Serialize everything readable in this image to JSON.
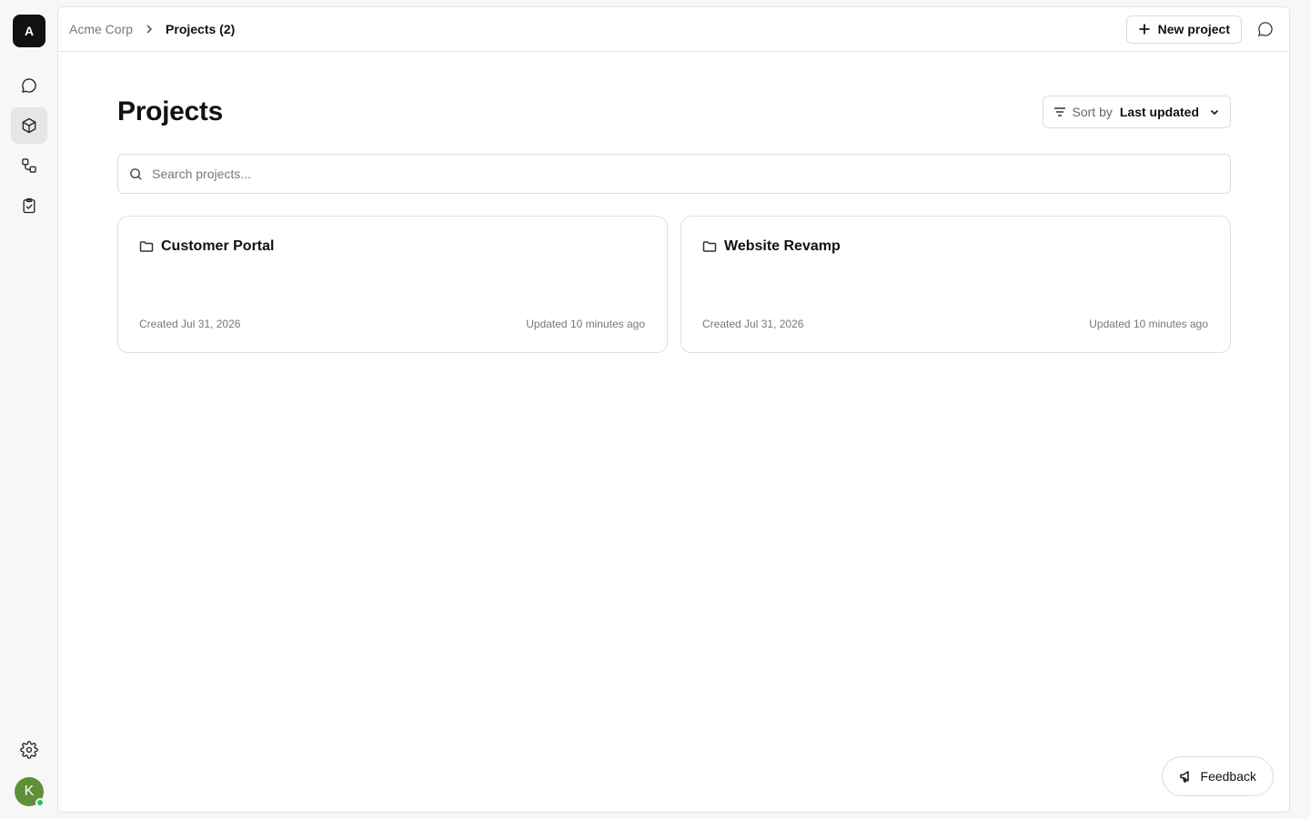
{
  "sidebar": {
    "org_initial": "A",
    "nav": [
      {
        "icon": "chat-bubble-icon",
        "active": false
      },
      {
        "icon": "cube-icon",
        "active": true
      },
      {
        "icon": "workflow-icon",
        "active": false
      },
      {
        "icon": "clipboard-check-icon",
        "active": false
      }
    ],
    "settings_icon": "gear-icon",
    "user_initial": "K",
    "user_status": "online",
    "avatar_color": "#5f8f36"
  },
  "topbar": {
    "breadcrumb_root": "Acme Corp",
    "breadcrumb_current": "Projects (2)",
    "new_project_label": "New project"
  },
  "main": {
    "title": "Projects",
    "sort_prefix": "Sort by",
    "sort_value": "Last updated",
    "search_placeholder": "Search projects...",
    "search_value": ""
  },
  "projects": [
    {
      "name": "Customer Portal",
      "created": "Created Jul 31, 2026",
      "updated": "Updated 10 minutes ago"
    },
    {
      "name": "Website Revamp",
      "created": "Created Jul 31, 2026",
      "updated": "Updated 10 minutes ago"
    }
  ],
  "feedback_label": "Feedback"
}
